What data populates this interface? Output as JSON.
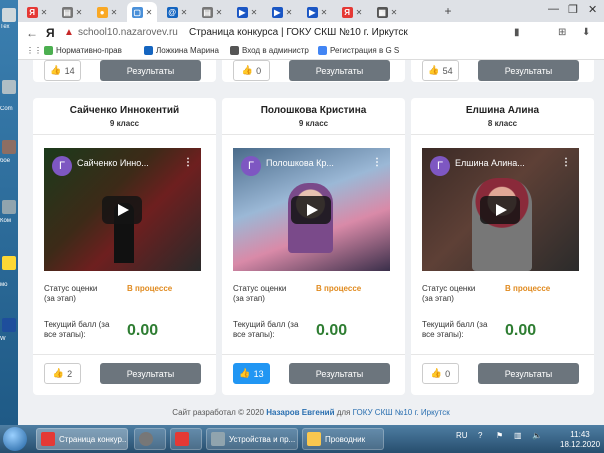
{
  "desktop": {
    "labels": [
      "Тех",
      "Com",
      "бое",
      "Ком",
      "мо",
      "W"
    ]
  },
  "browser": {
    "tabs": [
      {
        "icon": "yandex-icon",
        "fav": "Я",
        "color": "#e53935"
      },
      {
        "icon": "doc-icon",
        "fav": "▤",
        "color": "#777"
      },
      {
        "icon": "bee-icon",
        "fav": "●",
        "color": "#f9a825"
      },
      {
        "icon": "page-icon",
        "fav": "▢",
        "color": "#4a90d9"
      },
      {
        "icon": "mail-icon",
        "fav": "@",
        "color": "#1565c0"
      },
      {
        "icon": "doc-icon",
        "fav": "▤",
        "color": "#777"
      },
      {
        "icon": "video-icon",
        "fav": "▶",
        "color": "#1a56c4"
      },
      {
        "icon": "video-icon",
        "fav": "▶",
        "color": "#1a56c4"
      },
      {
        "icon": "video-icon",
        "fav": "▶",
        "color": "#1a56c4"
      },
      {
        "icon": "yandex-icon",
        "fav": "Я",
        "color": "#e53935"
      },
      {
        "icon": "photo-icon",
        "fav": "▦",
        "color": "#555"
      }
    ],
    "new_tab": "+",
    "address": {
      "back": "←",
      "yandex": "Я",
      "host": "school10.nazarovev.ru",
      "title": "Страница конкурса | ГОКУ СКШ №10 г. Иркутск"
    },
    "bookmarks": [
      {
        "label": "Нормативно-прав",
        "color": "#4caf50"
      },
      {
        "label": "Ложкина Марина",
        "color": "#1565c0"
      },
      {
        "label": "Вход в администр",
        "color": "#555"
      },
      {
        "label": "Регистрация в G S",
        "color": "#4285f4"
      }
    ]
  },
  "top_row": [
    {
      "likes": "14"
    },
    {
      "likes": "0"
    },
    {
      "likes": "54"
    }
  ],
  "cards": [
    {
      "name": "Сайченко Иннокентий",
      "grade": "9 класс",
      "video_title": "Сайченко Инно...",
      "avatar_letter": "Г",
      "status_label": "Статус оценки (за этап)",
      "status": "В процессе",
      "score_label": "Текущий балл (за все этапы):",
      "score": "0.00",
      "likes": "2",
      "liked": false,
      "results": "Результаты"
    },
    {
      "name": "Полошкова Кристина",
      "grade": "9 класс",
      "video_title": "Полошкова Кр...",
      "avatar_letter": "Г",
      "status_label": "Статус оценки (за этап)",
      "status": "В процессе",
      "score_label": "Текущий балл (за все этапы):",
      "score": "0.00",
      "likes": "13",
      "liked": true,
      "results": "Результаты"
    },
    {
      "name": "Елшина Алина",
      "grade": "8 класс",
      "video_title": "Елшина Алина...",
      "avatar_letter": "Г",
      "status_label": "Статус оценки (за этап)",
      "status": "В процессе",
      "score_label": "Текущий балл (за все этапы):",
      "score": "0.00",
      "likes": "0",
      "liked": false,
      "results": "Результаты"
    }
  ],
  "results_label": "Результаты",
  "footer": {
    "prefix": "Сайт разработал © 2020",
    "author": "Назаров Евгений",
    "mid": "для",
    "org": "ГОКУ СКШ №10 г. Иркутск"
  },
  "taskbar": {
    "items": [
      {
        "label": "Страница конкур...",
        "icon": "yandex-icon"
      },
      {
        "label": "",
        "icon": "media-icon"
      },
      {
        "label": "",
        "icon": "yandex-icon"
      },
      {
        "label": "Устройства и пр...",
        "icon": "devices-icon"
      },
      {
        "label": "Проводник",
        "icon": "folder-icon"
      }
    ],
    "lang": "RU",
    "time": "11:43",
    "date": "18.12.2020"
  }
}
